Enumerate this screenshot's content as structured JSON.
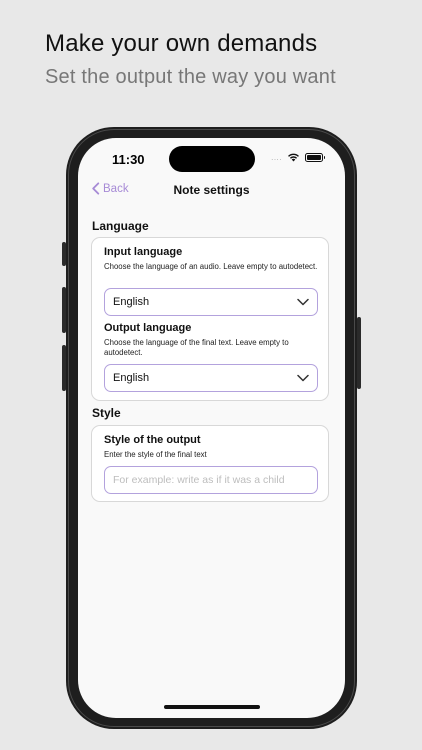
{
  "promo": {
    "title": "Make your own demands",
    "subtitle": "Set the output the way you want"
  },
  "status_bar": {
    "time": "11:30",
    "signal": "....",
    "icons": [
      "signal-icon",
      "wifi-icon",
      "battery-icon"
    ]
  },
  "nav": {
    "back_label": "Back",
    "title": "Note settings"
  },
  "language_section": {
    "heading": "Language",
    "input_language": {
      "label": "Input language",
      "description": "Choose the language of an audio. Leave empty to autodetect.",
      "value": "English"
    },
    "output_language": {
      "label": "Output language",
      "description": "Choose the language of the final text. Leave empty to autodetect.",
      "value": "English"
    }
  },
  "style_section": {
    "heading": "Style",
    "output_style": {
      "label": "Style of the output",
      "description": "Enter the style of the final text",
      "placeholder": "For example: write as if it was a child",
      "value": ""
    }
  },
  "colors": {
    "accent": "#a78bd6",
    "field_border": "#b3a2dd",
    "background": "#e8e8e8",
    "screen": "#f9f9f9"
  }
}
